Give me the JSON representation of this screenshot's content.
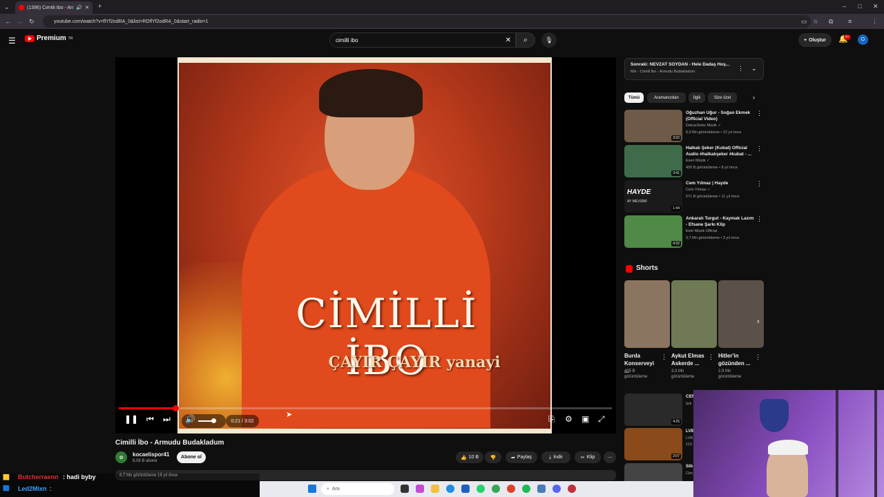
{
  "browser": {
    "tab_title": "(1396) Cimilli İbo - Armudu",
    "url": "youtube.com/watch?v=flYf2odRA_0&list=RDflYf2odRA_0&start_radio=1"
  },
  "header": {
    "logo_text": "Premium",
    "logo_sup": "TR",
    "search_value": "cimilli ibo",
    "create_label": "Oluştur",
    "notif_count": "9+",
    "avatar_letter": "O"
  },
  "player": {
    "art_title": "CİMİLLİ İBO",
    "art_subtitle": "ÇAYIR ÇAYIR yanayi",
    "time": "0:21 / 3:02",
    "progress": 0.1154
  },
  "video": {
    "title": "Cimilli İbo - Armudu Budakladum",
    "channel": "kocaelispor41",
    "subscribers": "8,08 B abone",
    "subscribe_label": "Abone ol",
    "likes": "10 B",
    "share": "Paylaş",
    "download": "İndir",
    "clip": "Klip",
    "views_meta": "6,7 Mn görüntüleme  18 yıl önce"
  },
  "next": {
    "title": "Sonraki: NEVZAT SOYDAN - Hele Dadaş Hoş...",
    "subtitle": "Mix - Cimilli İbo - Armudu Budakladum"
  },
  "chips": [
    "Tümü",
    "Aramanızdan",
    "İlgili",
    "Size özel"
  ],
  "recommendations": [
    {
      "title": "Oğuzhan Uğur - Soğan Ekmek (Official Video)",
      "channel": "DokuzSekiz Müzik ✓",
      "meta": "6,6 Mn görüntüleme • 12 yıl önce",
      "duration": "3:02",
      "color": "#6f5a48"
    },
    {
      "title": "Halkalı Şeker (Kubat) Official Audio #halkalışeker #kubat - ...",
      "channel": "Esen Müzik ✓",
      "meta": "430 B görüntüleme • 8 yıl önce",
      "duration": "3:41",
      "color": "#3f6b4a"
    },
    {
      "title": "Cem Yılmaz | Hayde",
      "channel": "Cem Yılmaz ✓",
      "meta": "571 B görüntüleme • 11 yıl önce",
      "duration": "1:44",
      "color": "#1a1a1a",
      "overlay": "HAYDE",
      "overlay_sub": "AY MEVSİMİ"
    },
    {
      "title": "Ankaralı Turgut - Kaymak Lazım - Efsane Şarkı Klip",
      "channel": "Emir Müzik Official",
      "meta": "3,7 Mn görüntüleme • 3 yıl önce",
      "duration": "4:32",
      "color": "#4f8a46"
    }
  ],
  "shorts": {
    "label": "Shorts",
    "items": [
      {
        "title": "Burda Konserveyi ...",
        "views": "405 B görüntüleme",
        "color": "#8c7560"
      },
      {
        "title": "Aykut Elmas Askerde ...",
        "views": "3,3 Mn görüntüleme",
        "color": "#6f7a55"
      },
      {
        "title": "Hitler'in gözünden ...",
        "views": "2,9 Mn görüntüleme",
        "color": "#5a5148"
      }
    ]
  },
  "lower_recs": [
    {
      "title": "CEN",
      "channel": "Işık",
      "duration": "4:25",
      "color": "#2a2a2a"
    },
    {
      "title": "LVB",
      "channel": "LVB",
      "meta": "113",
      "duration": "2:07",
      "color": "#8a4a1a"
    },
    {
      "title": "Sib",
      "channel": "Cim",
      "color": "#444"
    }
  ],
  "chat": {
    "user": "Butcherraenn",
    "message": ": hadi byby",
    "user2": "Led2Mixn",
    "sep2": ":"
  },
  "taskbar": {
    "search_placeholder": "Ara"
  }
}
